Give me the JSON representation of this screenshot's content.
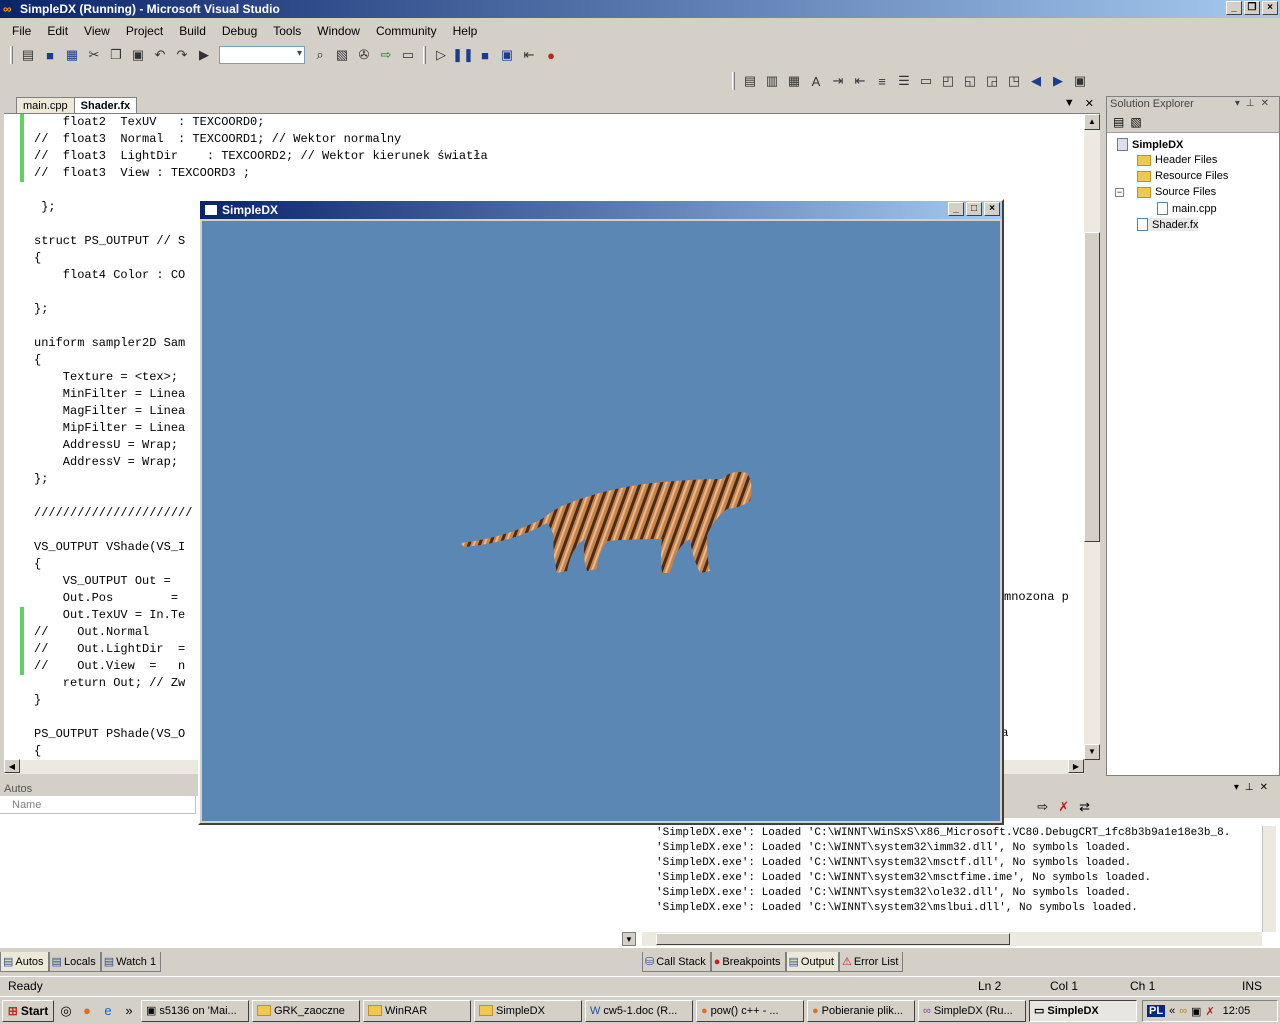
{
  "window": {
    "title": "SimpleDX (Running) - Microsoft Visual Studio"
  },
  "menu": [
    "File",
    "Edit",
    "View",
    "Project",
    "Build",
    "Debug",
    "Tools",
    "Window",
    "Community",
    "Help"
  ],
  "tabs": [
    {
      "label": "main.cpp"
    },
    {
      "label": "Shader.fx"
    }
  ],
  "code": [
    "    float2  TexUV   : TEXCOORD0;",
    "//  float3  Normal  : TEXCOORD1; // Wektor normalny",
    "//  float3  LightDir    : TEXCOORD2; // Wektor kierunek światła",
    "//  float3  View : TEXCOORD3 ;",
    "",
    " };",
    "",
    "struct PS_OUTPUT // S",
    "{",
    "    float4 Color : CO",
    "",
    "};",
    "",
    "uniform sampler2D Sam",
    "{",
    "    Texture = <tex>;",
    "    MinFilter = Linea",
    "    MagFilter = Linea",
    "    MipFilter = Linea",
    "    AddressU = Wrap;",
    "    AddressV = Wrap;",
    "};",
    "",
    "//////////////////////",
    "",
    "VS_OUTPUT VShade(VS_I",
    "{",
    "    VS_OUTPUT Out = ",
    "    Out.Pos        = ",
    "    Out.TexUV = In.Te",
    "//    Out.Normal    ",
    "//    Out.LightDir  =",
    "//    Out.View  =   n",
    "    return Out; // Zw",
    "}",
    "",
    "PS_OUTPUT PShade(VS_O",
    "{"
  ],
  "code_overflow": [
    "mnozona p",
    "ja"
  ],
  "solution_explorer": {
    "title": "Solution Explorer",
    "project": "SimpleDX",
    "items": [
      "Header Files",
      "Resource Files",
      "Source Files",
      "main.cpp",
      "Shader.fx"
    ]
  },
  "autos": {
    "title": "Autos",
    "column": "Name"
  },
  "output_lines": [
    "'SimpleDX.exe': Loaded 'C:\\WINNT\\WinSxS\\x86_Microsoft.VC80.DebugCRT_1fc8b3b9a1e18e3b_8.",
    "'SimpleDX.exe': Loaded 'C:\\WINNT\\system32\\imm32.dll', No symbols loaded.",
    "'SimpleDX.exe': Loaded 'C:\\WINNT\\system32\\msctf.dll', No symbols loaded.",
    "'SimpleDX.exe': Loaded 'C:\\WINNT\\system32\\msctfime.ime', No symbols loaded.",
    "'SimpleDX.exe': Loaded 'C:\\WINNT\\system32\\ole32.dll', No symbols loaded.",
    "'SimpleDX.exe': Loaded 'C:\\WINNT\\system32\\mslbui.dll', No symbols loaded."
  ],
  "left_tabs": [
    "Autos",
    "Locals",
    "Watch 1"
  ],
  "right_tabs": [
    "Call Stack",
    "Breakpoints",
    "Output",
    "Error List"
  ],
  "status": {
    "ready": "Ready",
    "ln": "Ln 2",
    "col": "Col 1",
    "ch": "Ch 1",
    "ins": "INS"
  },
  "taskbar": {
    "start": "Start",
    "tasks": [
      "s5136 on 'Mai...",
      "GRK_zaoczne",
      "WinRAR",
      "SimpleDX",
      "cw5-1.doc (R...",
      "pow() c++ - ...",
      "Pobieranie plik...",
      "SimpleDX (Ru...",
      "SimpleDX"
    ],
    "lang": "PL",
    "time": "12:05"
  },
  "dxwindow": {
    "title": "SimpleDX",
    "background": "#5b87b5"
  }
}
